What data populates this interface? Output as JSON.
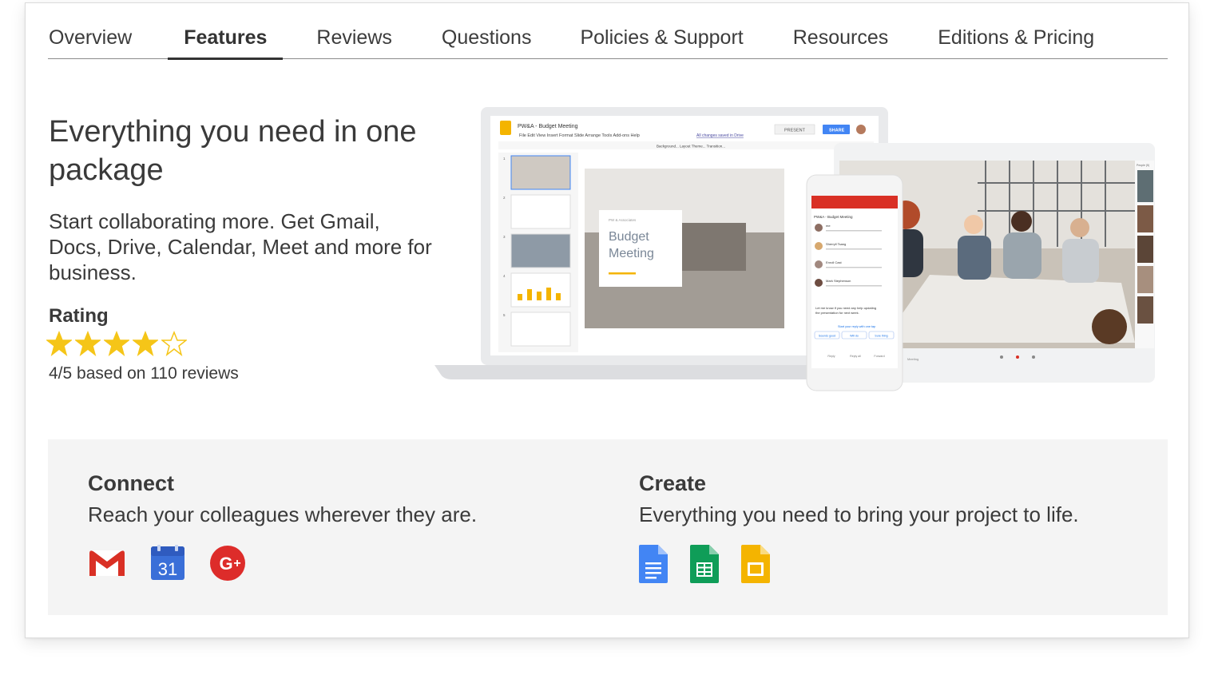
{
  "tabs": [
    {
      "label": "Overview",
      "active": false
    },
    {
      "label": "Features",
      "active": true
    },
    {
      "label": "Reviews",
      "active": false
    },
    {
      "label": "Questions",
      "active": false
    },
    {
      "label": "Policies & Support",
      "active": false
    },
    {
      "label": "Resources",
      "active": false
    },
    {
      "label": "Editions & Pricing",
      "active": false
    }
  ],
  "hero": {
    "title": "Everything you need in one package",
    "subtitle": "Start collaborating more. Get Gmail, Docs, Drive, Calendar, Meet and more for business.",
    "rating_label": "Rating",
    "rating_value": 4,
    "rating_max": 5,
    "rating_text": "4/5 based on 110 reviews",
    "star_color": "#f5c518"
  },
  "illustration": {
    "doc_title": "PW&A - Budget Meeting",
    "menu": [
      "File",
      "Edit",
      "View",
      "Insert",
      "Format",
      "Slide",
      "Arrange",
      "Tools",
      "Add-ons",
      "Help"
    ],
    "saved_note": "All changes saved in Drive",
    "present_label": "PRESENT",
    "share_label": "SHARE",
    "toolbar_items": [
      "Background...",
      "Layout",
      "Theme...",
      "Transition..."
    ],
    "slide_heading": "Budget Meeting",
    "slide_small": "PW & Associates",
    "phone_title": "PW&A - Budget Meeting",
    "phone_senders": [
      "me",
      "Sherryll Tsang",
      "Enroll Cast",
      "Mark Stephenson"
    ],
    "phone_body": "Let me know if you need any help updating the presentation for next week.",
    "phone_smart_reply": "Start your reply with one tap",
    "phone_chips": [
      "Sounds good",
      "Will do",
      "Sure thing"
    ],
    "phone_actions": [
      "Reply",
      "Reply all",
      "Forward"
    ],
    "meet_people_label": "People (5)",
    "meet_meeting_label": "Meeting"
  },
  "panel": {
    "connect_title": "Connect",
    "connect_desc": "Reach your colleagues wherever they are.",
    "connect_icons": [
      "gmail-icon",
      "calendar-icon",
      "google-plus-icon"
    ],
    "calendar_day": "31",
    "create_title": "Create",
    "create_desc": "Everything you need to bring your project to life.",
    "create_icons": [
      "docs-icon",
      "sheets-icon",
      "slides-icon"
    ]
  },
  "colors": {
    "gmail_red": "#d93025",
    "calendar_blue": "#3a6fd8",
    "gplus_red": "#dd2c2a",
    "docs_blue": "#4285f4",
    "sheets_green": "#0f9d58",
    "slides_yellow": "#f4b400"
  }
}
